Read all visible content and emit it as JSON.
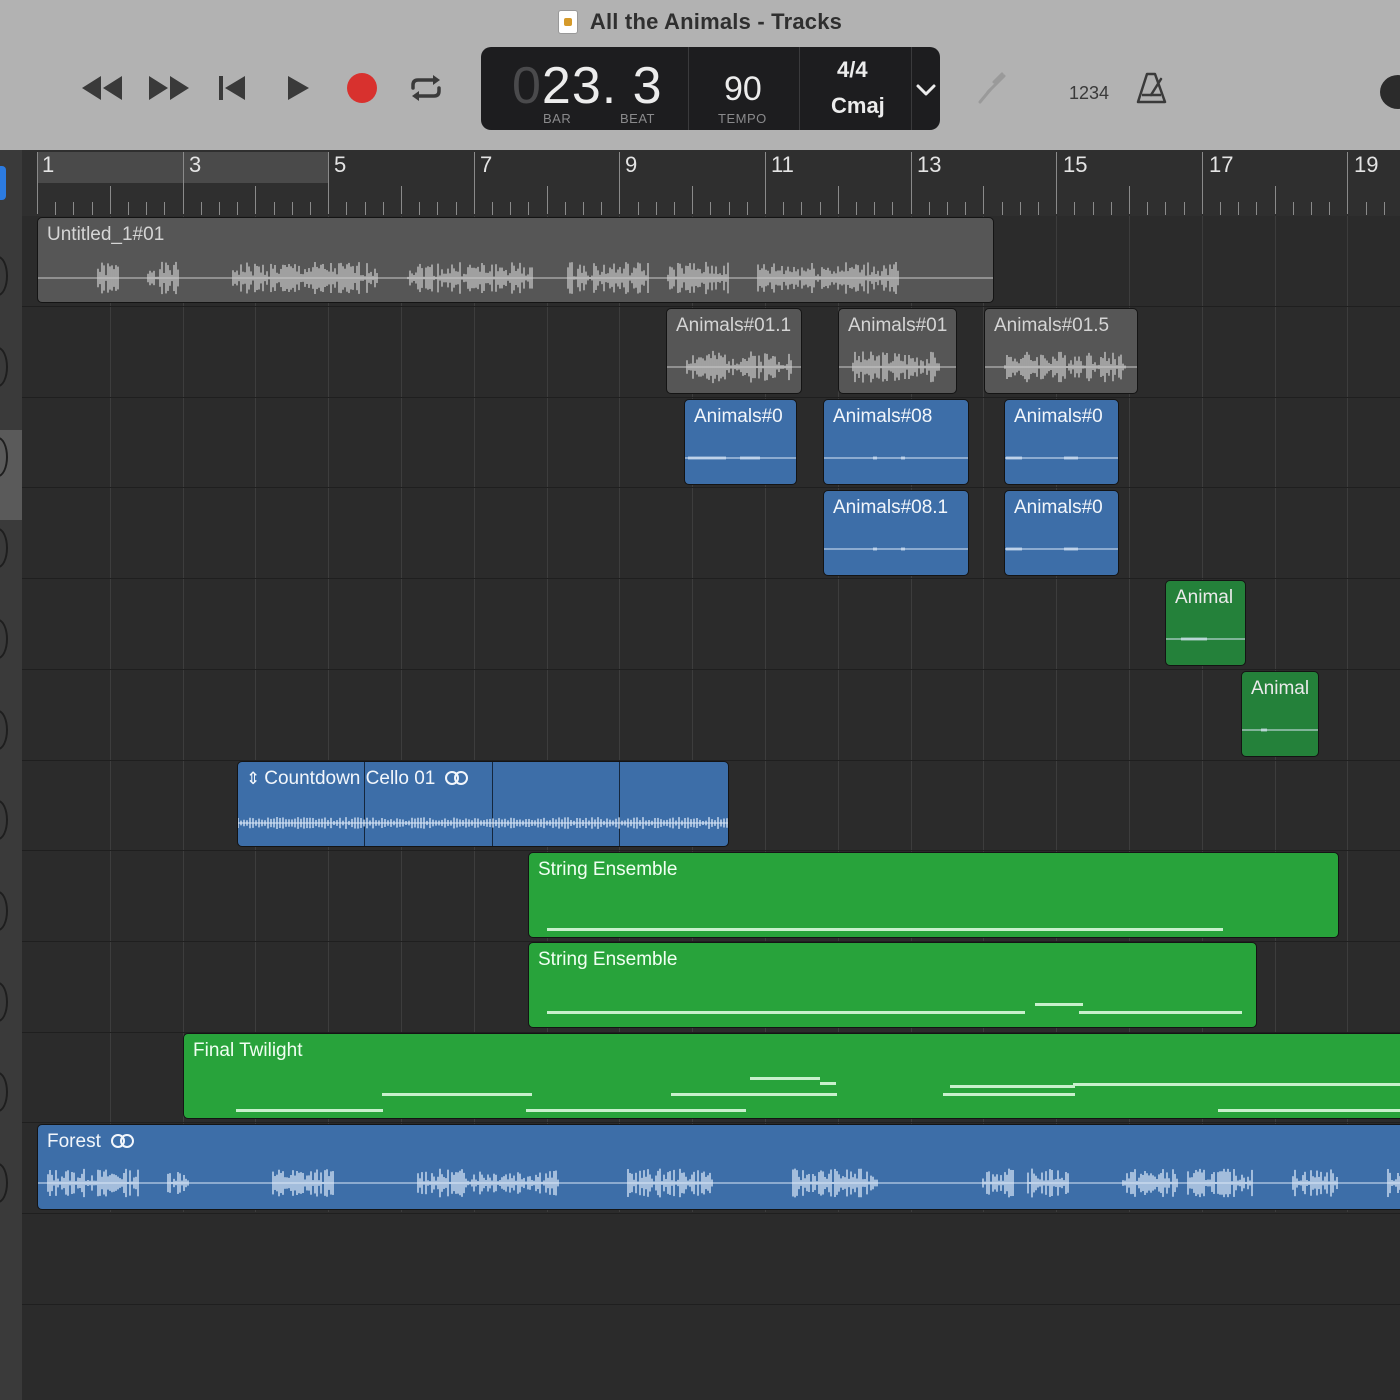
{
  "window": {
    "title": "All the Animals - Tracks"
  },
  "transport": {
    "rewind": "rewind-icon",
    "fast_forward": "fast-forward-icon",
    "go_to_start": "go-to-start-icon",
    "play": "play-icon",
    "record": "record-icon",
    "cycle": "cycle-icon",
    "record_color": "#d8312e"
  },
  "lcd": {
    "position_dim": "0",
    "position_bar": "23.",
    "position_beat": " 3",
    "bar_label": "BAR",
    "beat_label": "BEAT",
    "tempo": "90",
    "tempo_label": "TEMPO",
    "time_signature": "4/4",
    "key": "Cmaj"
  },
  "toolbar": {
    "tuner": "tuner-icon",
    "count_in": "1234",
    "metronome": "metronome-icon"
  },
  "ruler": {
    "bars": [
      "1",
      "3",
      "5",
      "7",
      "9",
      "11",
      "13",
      "15",
      "17",
      "19"
    ],
    "cycle_range": "1-5"
  },
  "regions": [
    {
      "name": "Untitled_1#01",
      "type": "audio",
      "color": "gray"
    },
    {
      "name": "Animals#01.1",
      "type": "audio",
      "color": "gray"
    },
    {
      "name": "Animals#01",
      "type": "audio",
      "color": "gray"
    },
    {
      "name": "Animals#01.5",
      "type": "audio",
      "color": "gray"
    },
    {
      "name": "Animals#0",
      "type": "audio",
      "color": "blue"
    },
    {
      "name": "Animals#08",
      "type": "audio",
      "color": "blue"
    },
    {
      "name": "Animals#0",
      "type": "audio",
      "color": "blue"
    },
    {
      "name": "Animals#08.1",
      "type": "audio",
      "color": "blue"
    },
    {
      "name": "Animals#0",
      "type": "audio",
      "color": "blue"
    },
    {
      "name": "Animal",
      "type": "midi",
      "color": "dark-green"
    },
    {
      "name": "Animal",
      "type": "midi",
      "color": "dark-green"
    },
    {
      "name": "Countdown Cello 01",
      "type": "loop",
      "color": "blue"
    },
    {
      "name": "String Ensemble",
      "type": "midi",
      "color": "green"
    },
    {
      "name": "String Ensemble",
      "type": "midi",
      "color": "green"
    },
    {
      "name": "Final Twilight",
      "type": "midi",
      "color": "green"
    },
    {
      "name": "Forest",
      "type": "loop",
      "color": "blue"
    }
  ],
  "colors": {
    "audio_blue": "#3d6ea8",
    "midi_green": "#28a33b",
    "muted_gray": "#565656",
    "selection_blue": "#2c7be0"
  }
}
